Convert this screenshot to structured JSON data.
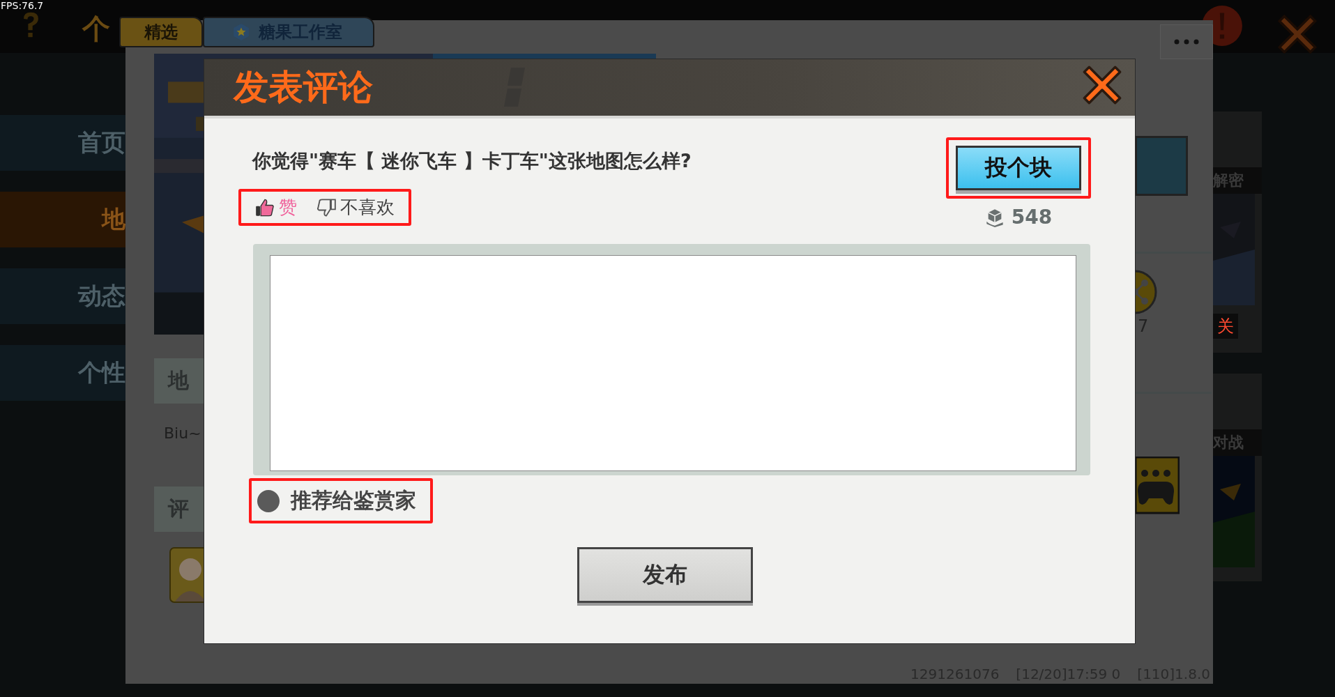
{
  "hud": {
    "fps": "FPS:76.7",
    "title": "个"
  },
  "tabs": [
    {
      "label": "精选",
      "selected": true
    },
    {
      "label": "糖果工作室",
      "selected": false
    }
  ],
  "sidebar": {
    "items": [
      {
        "label": "首页",
        "selected": false
      },
      {
        "label": "地",
        "selected": true
      },
      {
        "label": "动态",
        "selected": false
      },
      {
        "label": "个性",
        "selected": false
      }
    ]
  },
  "panel": {
    "map_heading": "地",
    "map_text": "Biu~",
    "comment_heading": "评",
    "share_count": "7",
    "version_info": [
      "1291261076",
      "[12/20]17:59 0",
      "[110]1.8.0"
    ]
  },
  "side_cards": [
    {
      "label": "解密",
      "note": "关"
    },
    {
      "label": "对战"
    }
  ],
  "dialog": {
    "title": "发表评论",
    "question": "你觉得\"赛车【 迷你飞车 】卡丁车\"这张地图怎么样?",
    "reactions": [
      {
        "kind": "like",
        "label": "赞"
      },
      {
        "kind": "dislike",
        "label": "不喜欢"
      }
    ],
    "give_button": "投个块",
    "block_count": "548",
    "recommend": {
      "label": "推荐给鉴赏家",
      "checked": false
    },
    "publish_button": "发布"
  }
}
